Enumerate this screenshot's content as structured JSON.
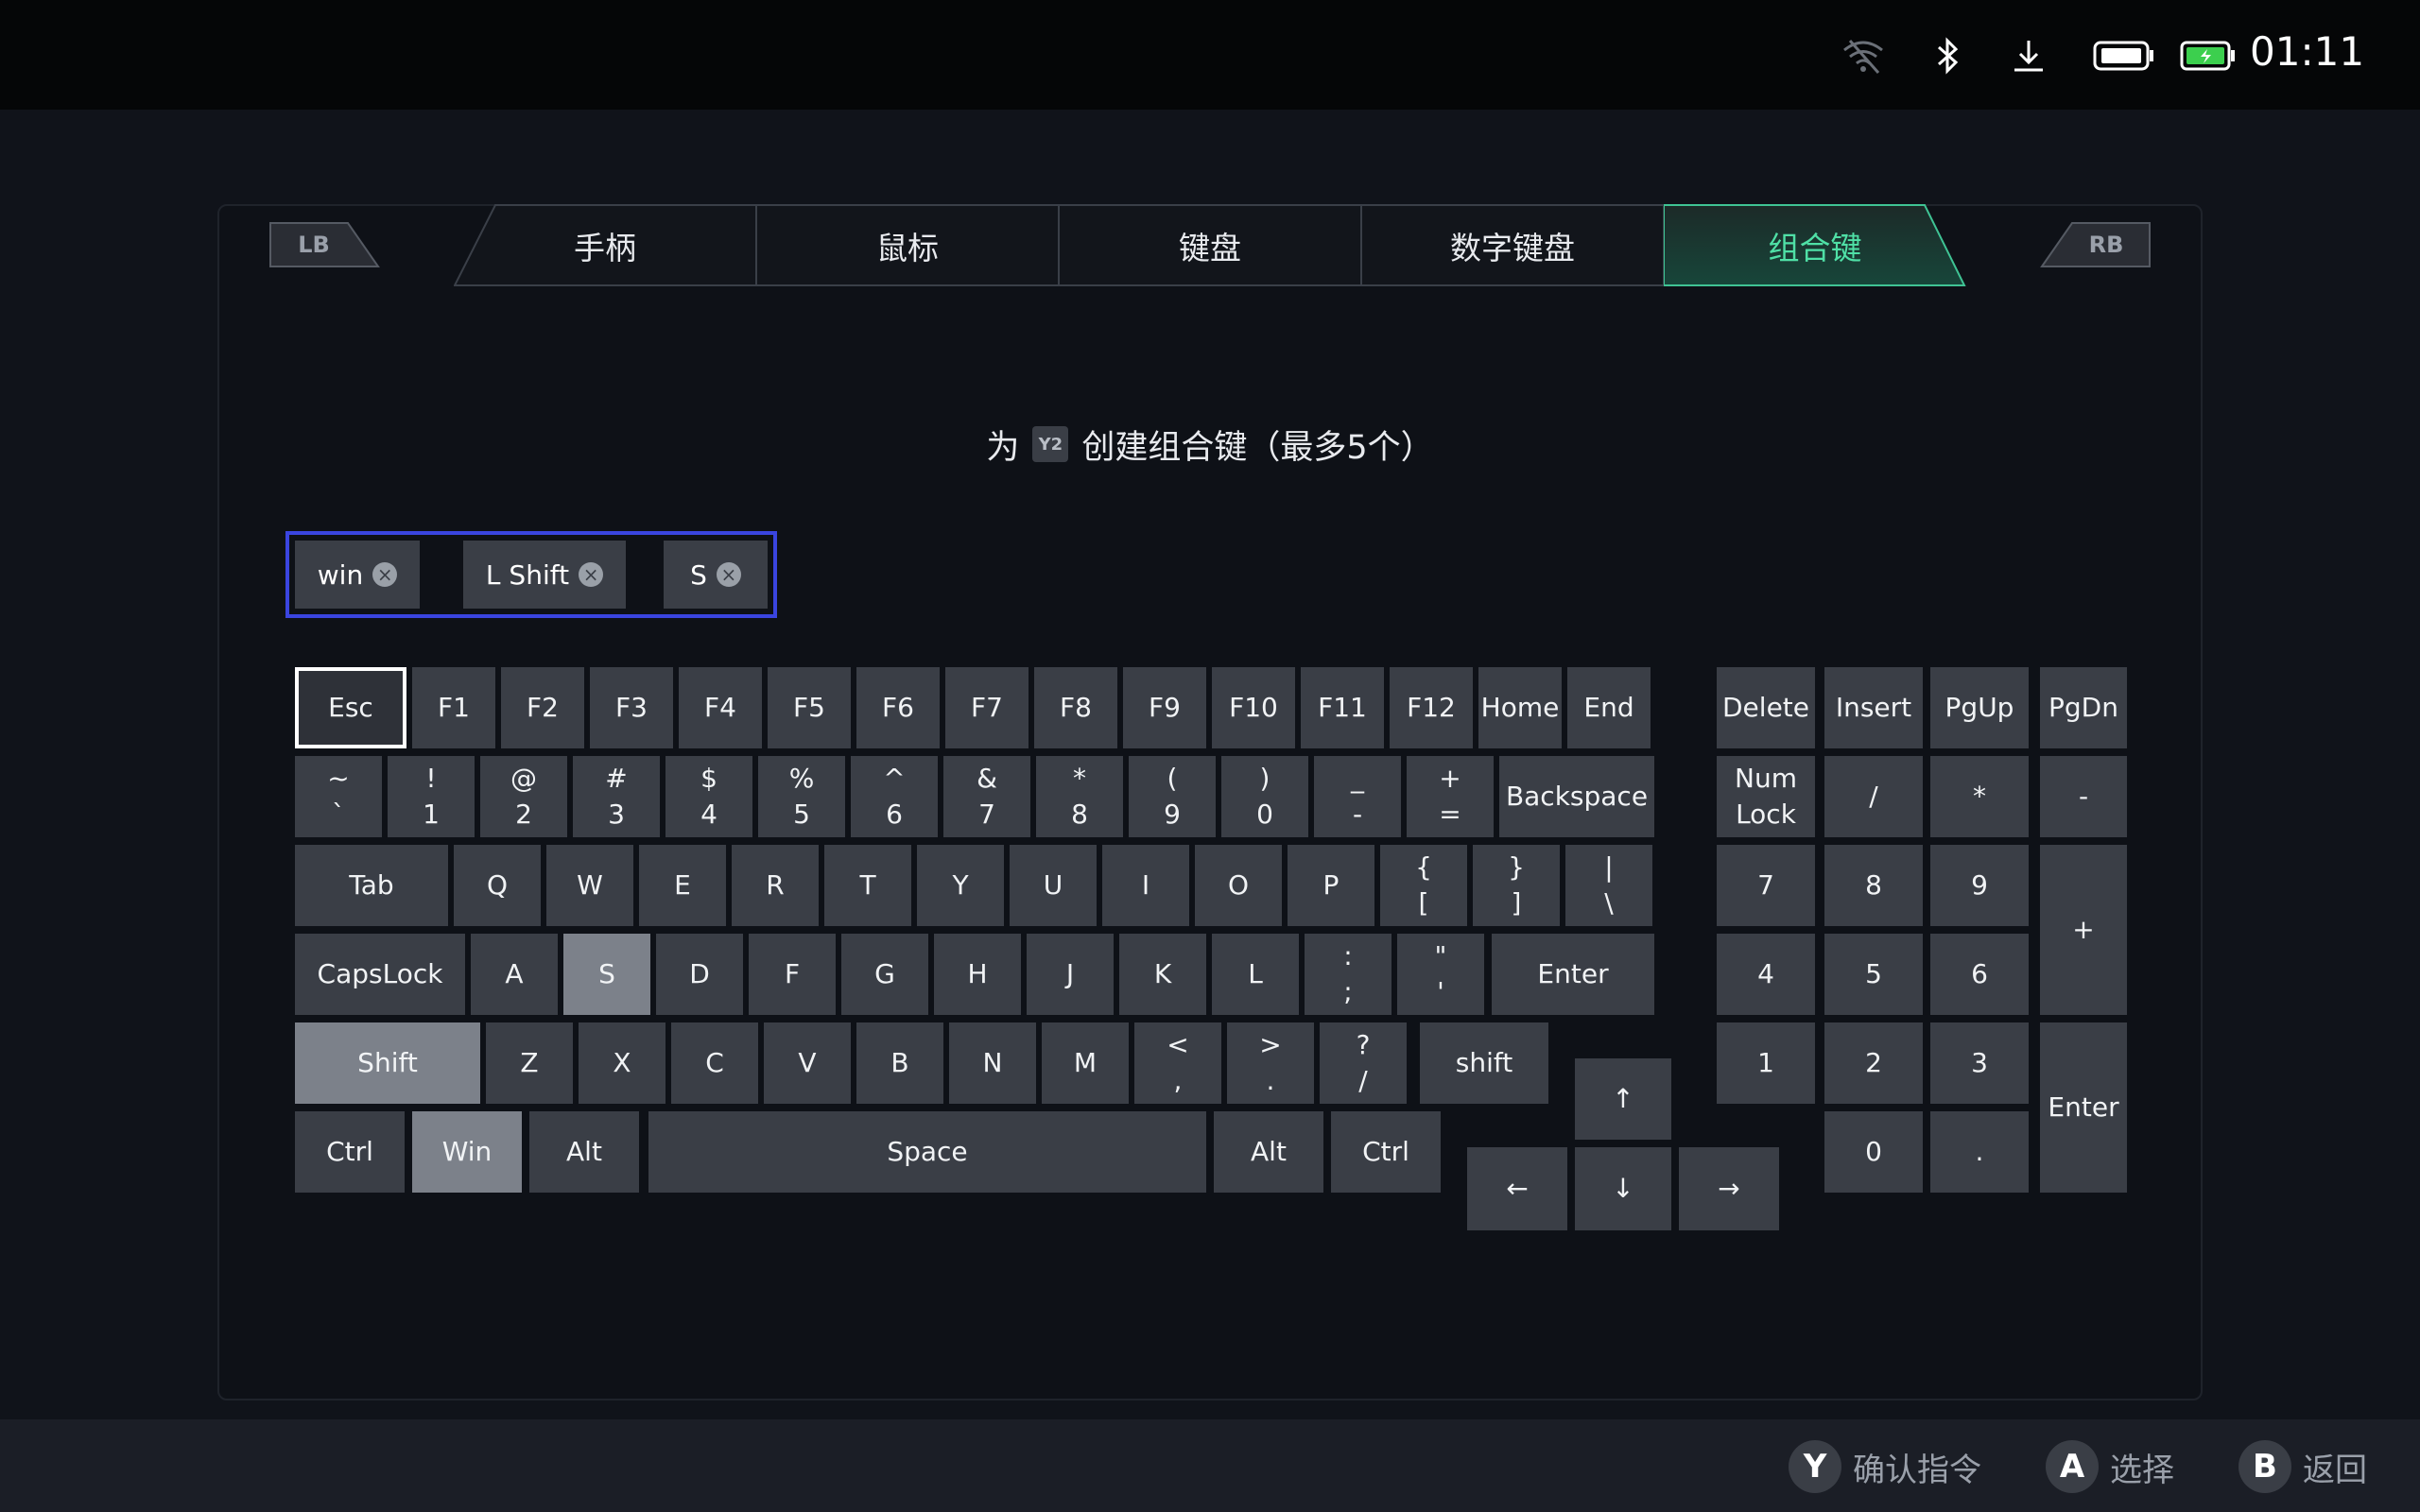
{
  "status": {
    "time": "01:11"
  },
  "shoulders": {
    "left": "LB",
    "right": "RB"
  },
  "tabs": [
    "手柄",
    "鼠标",
    "键盘",
    "数字键盘",
    "组合键"
  ],
  "active_tab": "组合键",
  "instruction": {
    "prefix": "为",
    "badge": "Y2",
    "suffix": "创建组合键（最多5个）"
  },
  "combo_keys": [
    "win",
    "L Shift",
    "S"
  ],
  "keyboard": {
    "row0": [
      "Esc",
      "F1",
      "F2",
      "F3",
      "F4",
      "F5",
      "F6",
      "F7",
      "F8",
      "F9",
      "F10",
      "F11",
      "F12",
      "Home",
      "End"
    ],
    "row1": [
      [
        "~",
        "`"
      ],
      [
        "!",
        "1"
      ],
      [
        "@",
        "2"
      ],
      [
        "#",
        "3"
      ],
      [
        "$",
        "4"
      ],
      [
        "%",
        "5"
      ],
      [
        "^",
        "6"
      ],
      [
        "&",
        "7"
      ],
      [
        "*",
        "8"
      ],
      [
        "(",
        "9"
      ],
      [
        ")",
        "0"
      ],
      [
        "_",
        "-"
      ],
      [
        "+",
        "="
      ],
      [
        "Backspace"
      ]
    ],
    "row2": [
      [
        "Tab"
      ],
      [
        "Q"
      ],
      [
        "W"
      ],
      [
        "E"
      ],
      [
        "R"
      ],
      [
        "T"
      ],
      [
        "Y"
      ],
      [
        "U"
      ],
      [
        "I"
      ],
      [
        "O"
      ],
      [
        "P"
      ],
      [
        "{",
        "["
      ],
      [
        "}",
        "]"
      ],
      [
        "|",
        "\\"
      ]
    ],
    "row3": [
      [
        "CapsLock"
      ],
      [
        "A"
      ],
      [
        "S"
      ],
      [
        "D"
      ],
      [
        "F"
      ],
      [
        "G"
      ],
      [
        "H"
      ],
      [
        "J"
      ],
      [
        "K"
      ],
      [
        "L"
      ],
      [
        ":",
        ";"
      ],
      [
        "\"",
        "'"
      ],
      [
        "Enter"
      ]
    ],
    "row4": [
      [
        "Shift"
      ],
      [
        "Z"
      ],
      [
        "X"
      ],
      [
        "C"
      ],
      [
        "V"
      ],
      [
        "B"
      ],
      [
        "N"
      ],
      [
        "M"
      ],
      [
        "<",
        ","
      ],
      [
        ">",
        "."
      ],
      [
        "?",
        "/"
      ],
      [
        "shift"
      ]
    ],
    "row5": [
      "Ctrl",
      "Win",
      "Alt",
      "Space",
      "Alt",
      "Ctrl"
    ],
    "arrows": {
      "up": "↑",
      "left": "←",
      "down": "↓",
      "right": "→"
    }
  },
  "nav_keys": [
    "Delete",
    "Insert",
    "PgUp",
    "PgDn"
  ],
  "numpad": {
    "numlock": [
      "Num",
      "Lock"
    ],
    "slash": "/",
    "star": "*",
    "minus": "-",
    "plus": "+",
    "enter": "Enter",
    "digits": [
      "7",
      "8",
      "9",
      "4",
      "5",
      "6",
      "1",
      "2",
      "3",
      "0",
      "."
    ]
  },
  "selected_keys": [
    "S",
    "Shift",
    "Win"
  ],
  "focused_key": "Esc",
  "hints": [
    {
      "button": "Y",
      "label": "确认指令"
    },
    {
      "button": "A",
      "label": "选择"
    },
    {
      "button": "B",
      "label": "返回"
    }
  ]
}
